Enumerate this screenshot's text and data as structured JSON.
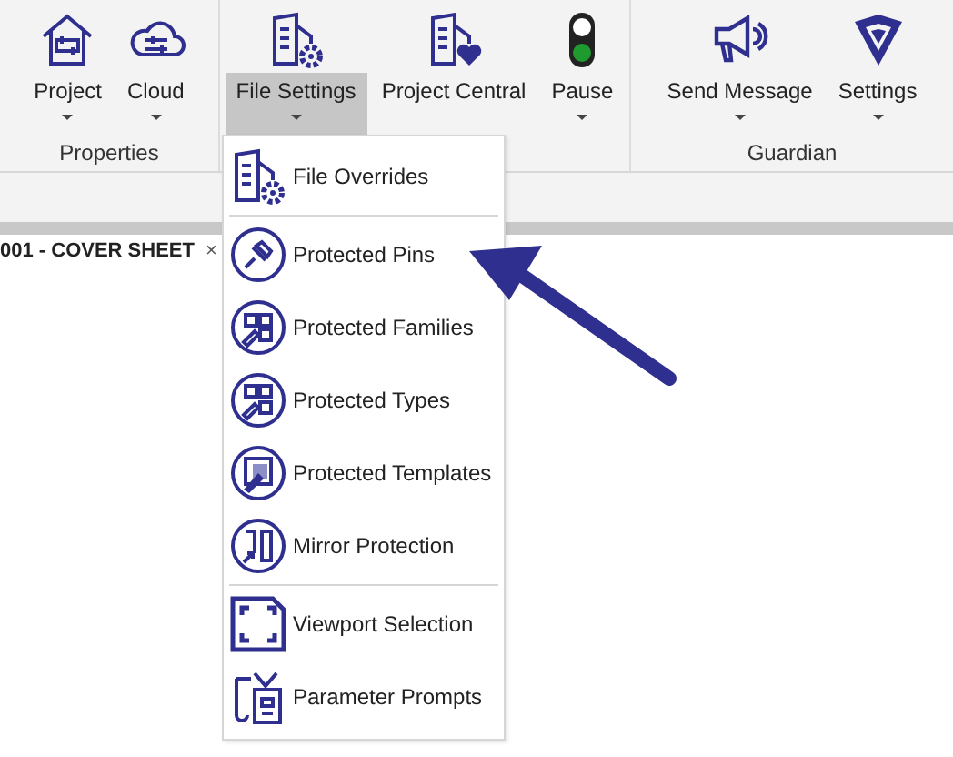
{
  "ribbon": {
    "groups": [
      {
        "label": "Properties",
        "buttons": [
          {
            "label": "Project",
            "dropdown": true,
            "selected": false
          },
          {
            "label": "Cloud",
            "dropdown": true,
            "selected": false
          }
        ]
      },
      {
        "buttons": [
          {
            "label": "File Settings",
            "dropdown": true,
            "selected": true
          },
          {
            "label": "Project Central",
            "dropdown": false,
            "selected": false
          },
          {
            "label": "Pause",
            "dropdown": true,
            "selected": false
          }
        ]
      },
      {
        "label": "Guardian",
        "buttons": [
          {
            "label": "Send Message",
            "dropdown": true,
            "selected": false
          },
          {
            "label": "Settings",
            "dropdown": true,
            "selected": false
          }
        ]
      }
    ]
  },
  "document_tab": {
    "title": "001 - COVER SHEET",
    "close": "×"
  },
  "menu": {
    "sections": [
      [
        {
          "label": "File Overrides"
        }
      ],
      [
        {
          "label": "Protected Pins"
        },
        {
          "label": "Protected Families"
        },
        {
          "label": "Protected Types"
        },
        {
          "label": "Protected Templates"
        },
        {
          "label": "Mirror Protection"
        }
      ],
      [
        {
          "label": "Viewport Selection"
        },
        {
          "label": "Parameter Prompts"
        }
      ]
    ]
  }
}
